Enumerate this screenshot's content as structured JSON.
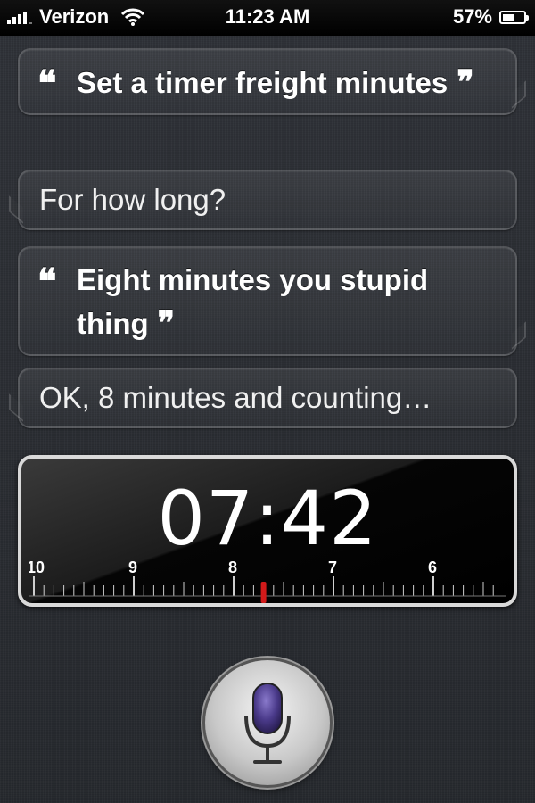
{
  "status_bar": {
    "carrier": "Verizon",
    "time": "11:23 AM",
    "battery_percent": "57%",
    "battery_level": 0.57
  },
  "conversation": [
    {
      "role": "user",
      "text": "Set a timer freight minutes"
    },
    {
      "role": "siri",
      "text": "For how long?"
    },
    {
      "role": "user",
      "text": "Eight minutes you stupid thing"
    },
    {
      "role": "siri",
      "text": "OK, 8 minutes and counting…"
    }
  ],
  "quotes": {
    "open": "❝",
    "close": "❞"
  },
  "timer": {
    "display": "07:42",
    "scale_labels": [
      "10",
      "9",
      "8",
      "7",
      "6"
    ],
    "current_minutes": 7.7,
    "indicator_color": "#d21a1a"
  },
  "mic_button": {
    "icon": "microphone-icon",
    "accent": "#4a3a8a"
  }
}
